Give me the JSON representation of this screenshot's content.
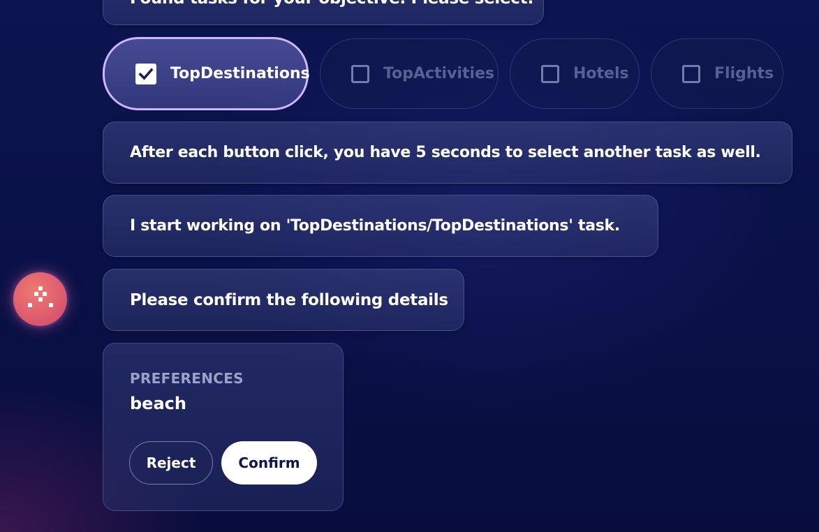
{
  "messages": {
    "partial_top": "Found tasks for your objective. Please select:",
    "timer_note": "After each button click, you have 5 seconds to select another task as well.",
    "working": "I start working on 'TopDestinations/TopDestinations' task.",
    "confirm_prompt": "Please confirm the following details"
  },
  "task_options": [
    {
      "label": "TopDestinations",
      "checked": true
    },
    {
      "label": "TopActivities",
      "checked": false
    },
    {
      "label": "Hotels",
      "checked": false
    },
    {
      "label": "Flights",
      "checked": false
    }
  ],
  "details_card": {
    "field_label": "PREFERENCES",
    "field_value": "beach",
    "reject_label": "Reject",
    "confirm_label": "Confirm"
  },
  "assistant": {
    "icon": "assistant-logo-icon"
  },
  "colors": {
    "background": "#0a1148",
    "selected_border": "#cbb8ff",
    "confirm_button_bg": "#ffffff",
    "confirm_button_text": "#0e1650",
    "avatar": "#e0606e"
  }
}
